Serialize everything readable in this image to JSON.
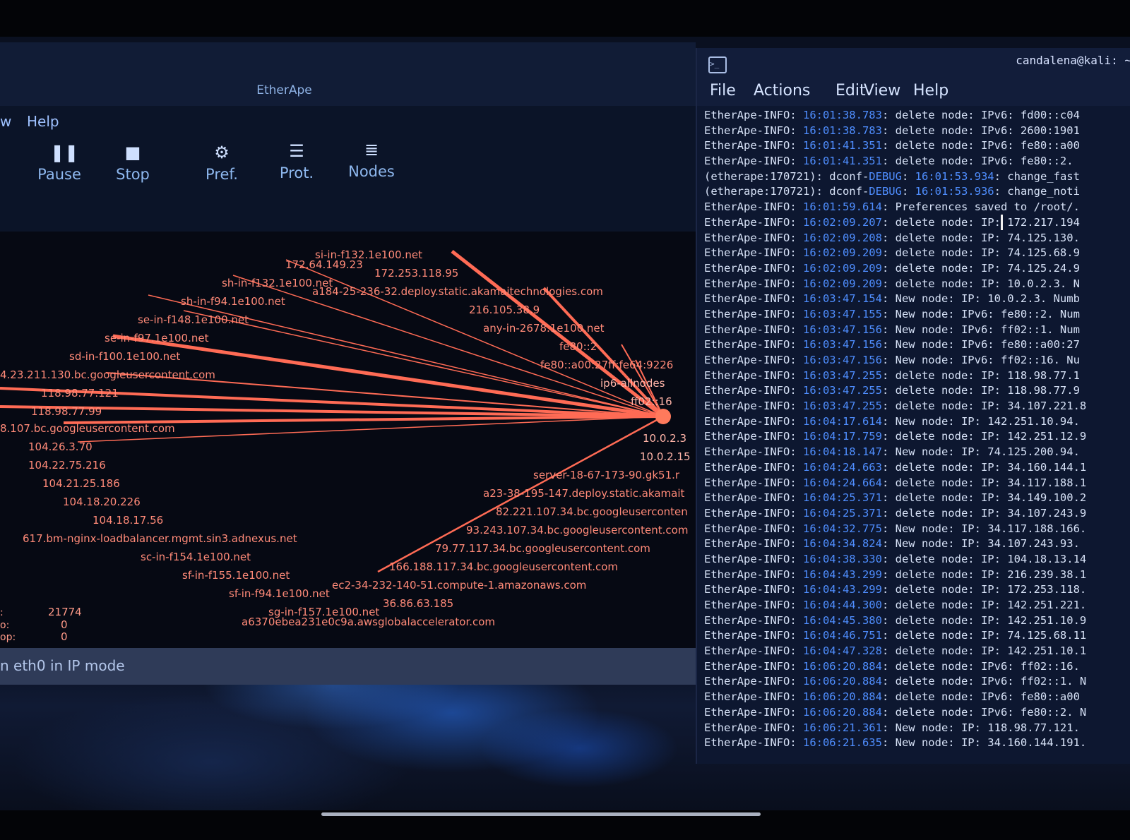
{
  "etherape": {
    "title": "EtherApe",
    "menu": [
      "w",
      "Help"
    ],
    "toolbar": [
      {
        "label": "Pause",
        "icon": "pause-icon"
      },
      {
        "label": "Stop",
        "icon": "stop-icon"
      },
      {
        "label": "Pref.",
        "icon": "preferences-icon"
      },
      {
        "label": "Prot.",
        "icon": "protocols-icon"
      },
      {
        "label": "Nodes",
        "icon": "nodes-icon"
      }
    ],
    "nodes": [
      "si-in-f132.1e100.net",
      "172.64.149.23",
      "172.253.118.95",
      "sh-in-f132.1e100.net",
      "a184-25-236-32.deploy.static.akamaitechnologies.com",
      "sh-in-f94.1e100.net",
      "216.105.38.9",
      "se-in-f148.1e100.net",
      "any-in-2678.1e100.net",
      "se-in-f97.1e100.net",
      "fe80::2",
      "sd-in-f100.1e100.net",
      "fe80::a00:27ff:fe64:9226",
      "4.23.211.130.bc.googleusercontent.com",
      "ip6-allnodes",
      "118.98.77.121",
      "ff02::16",
      "118.98.77.99",
      "8.107.bc.googleusercontent.com",
      "10.0.2.3",
      "104.26.3.70",
      "10.0.2.15",
      "104.22.75.216",
      "server-18-67-173-90.gk51.r",
      "104.21.25.186",
      "a23-38-195-147.deploy.static.akamait",
      "104.18.20.226",
      "82.221.107.34.bc.googleuserconten",
      "104.18.17.56",
      "93.243.107.34.bc.googleusercontent.com",
      "617.bm-nginx-loadbalancer.mgmt.sin3.adnexus.net",
      "79.77.117.34.bc.googleusercontent.com",
      "sc-in-f154.1e100.net",
      "166.188.117.34.bc.googleusercontent.com",
      "sf-in-f155.1e100.net",
      "ec2-34-232-140-51.compute-1.amazonaws.com",
      "sf-in-f94.1e100.net",
      "36.86.63.185",
      "sg-in-f157.1e100.net",
      "a6370ebea231e0c9a.awsglobalaccelerator.com"
    ],
    "stats": {
      "keys": [
        ":",
        "o:",
        "op:"
      ],
      "values": [
        "21774",
        "0",
        "0"
      ]
    },
    "status": "n eth0 in IP mode",
    "colors": {
      "links": "#ff6b55",
      "labels": "#ff8a78",
      "hub": "#ff7a5c"
    }
  },
  "terminal": {
    "user": "candalena@kali: ~",
    "menu": [
      "File",
      "Actions",
      "Edit",
      "View",
      "Help"
    ],
    "log": [
      {
        "p": "EtherApe-INFO: ",
        "t": "16:01:38.783",
        "m": ": delete node: IPv6: fd00::c04"
      },
      {
        "p": "EtherApe-INFO: ",
        "t": "16:01:38.783",
        "m": ": delete node: IPv6: 2600:1901"
      },
      {
        "p": "EtherApe-INFO: ",
        "t": "16:01:41.351",
        "m": ": delete node: IPv6: fe80::a00"
      },
      {
        "p": "EtherApe-INFO: ",
        "t": "16:01:41.351",
        "m": ": delete node: IPv6: fe80::2."
      },
      {
        "p": "(etherape:170721): dconf-",
        "d": "DEBUG",
        "p2": ": ",
        "t": "16:01:53.934",
        "m": ": change_fast"
      },
      {
        "p": "(etherape:170721): dconf-",
        "d": "DEBUG",
        "p2": ": ",
        "t": "16:01:53.936",
        "m": ": change_noti"
      },
      {
        "p": "EtherApe-INFO: ",
        "t": "16:01:59.614",
        "m": ": Preferences saved to /root/."
      },
      {
        "p": "EtherApe-INFO: ",
        "t": "16:02:09.207",
        "m": ": delete node: IP: 172.217.194"
      },
      {
        "p": "EtherApe-INFO: ",
        "t": "16:02:09.208",
        "m": ": delete node: IP: 74.125.130."
      },
      {
        "p": "EtherApe-INFO: ",
        "t": "16:02:09.209",
        "m": ": delete node: IP: 74.125.68.9"
      },
      {
        "p": "EtherApe-INFO: ",
        "t": "16:02:09.209",
        "m": ": delete node: IP: 74.125.24.9"
      },
      {
        "p": "EtherApe-INFO: ",
        "t": "16:02:09.209",
        "m": ": delete node: IP: 10.0.2.3. N"
      },
      {
        "p": "EtherApe-INFO: ",
        "t": "16:03:47.154",
        "m": ": New node: IP: 10.0.2.3. Numb"
      },
      {
        "p": "EtherApe-INFO: ",
        "t": "16:03:47.155",
        "m": ": New node: IPv6: fe80::2. Num"
      },
      {
        "p": "EtherApe-INFO: ",
        "t": "16:03:47.156",
        "m": ": New node: IPv6: ff02::1. Num"
      },
      {
        "p": "EtherApe-INFO: ",
        "t": "16:03:47.156",
        "m": ": New node: IPv6: fe80::a00:27"
      },
      {
        "p": "EtherApe-INFO: ",
        "t": "16:03:47.156",
        "m": ": New node: IPv6: ff02::16. Nu"
      },
      {
        "p": "EtherApe-INFO: ",
        "t": "16:03:47.255",
        "m": ": delete node: IP: 118.98.77.1"
      },
      {
        "p": "EtherApe-INFO: ",
        "t": "16:03:47.255",
        "m": ": delete node: IP: 118.98.77.9"
      },
      {
        "p": "EtherApe-INFO: ",
        "t": "16:03:47.255",
        "m": ": delete node: IP: 34.107.221.8"
      },
      {
        "p": "EtherApe-INFO: ",
        "t": "16:04:17.614",
        "m": ": New node: IP: 142.251.10.94."
      },
      {
        "p": "EtherApe-INFO: ",
        "t": "16:04:17.759",
        "m": ": delete node: IP: 142.251.12.9"
      },
      {
        "p": "EtherApe-INFO: ",
        "t": "16:04:18.147",
        "m": ": New node: IP: 74.125.200.94."
      },
      {
        "p": "EtherApe-INFO: ",
        "t": "16:04:24.663",
        "m": ": delete node: IP: 34.160.144.1"
      },
      {
        "p": "EtherApe-INFO: ",
        "t": "16:04:24.664",
        "m": ": delete node: IP: 34.117.188.1"
      },
      {
        "p": "EtherApe-INFO: ",
        "t": "16:04:25.371",
        "m": ": delete node: IP: 34.149.100.2"
      },
      {
        "p": "EtherApe-INFO: ",
        "t": "16:04:25.371",
        "m": ": delete node: IP: 34.107.243.9"
      },
      {
        "p": "EtherApe-INFO: ",
        "t": "16:04:32.775",
        "m": ": New node: IP: 34.117.188.166."
      },
      {
        "p": "EtherApe-INFO: ",
        "t": "16:04:34.824",
        "m": ": New node: IP: 34.107.243.93."
      },
      {
        "p": "EtherApe-INFO: ",
        "t": "16:04:38.330",
        "m": ": delete node: IP: 104.18.13.14"
      },
      {
        "p": "EtherApe-INFO: ",
        "t": "16:04:43.299",
        "m": ": delete node: IP: 216.239.38.1"
      },
      {
        "p": "EtherApe-INFO: ",
        "t": "16:04:43.299",
        "m": ": delete node: IP: 172.253.118."
      },
      {
        "p": "EtherApe-INFO: ",
        "t": "16:04:44.300",
        "m": ": delete node: IP: 142.251.221."
      },
      {
        "p": "EtherApe-INFO: ",
        "t": "16:04:45.380",
        "m": ": delete node: IP: 142.251.10.9"
      },
      {
        "p": "EtherApe-INFO: ",
        "t": "16:04:46.751",
        "m": ": delete node: IP: 74.125.68.11"
      },
      {
        "p": "EtherApe-INFO: ",
        "t": "16:04:47.328",
        "m": ": delete node: IP: 142.251.10.1"
      },
      {
        "p": "EtherApe-INFO: ",
        "t": "16:06:20.884",
        "m": ": delete node: IPv6: ff02::16."
      },
      {
        "p": "EtherApe-INFO: ",
        "t": "16:06:20.884",
        "m": ": delete node: IPv6: ff02::1. N"
      },
      {
        "p": "EtherApe-INFO: ",
        "t": "16:06:20.884",
        "m": ": delete node: IPv6: fe80::a00"
      },
      {
        "p": "EtherApe-INFO: ",
        "t": "16:06:20.884",
        "m": ": delete node: IPv6: fe80::2. N"
      },
      {
        "p": "EtherApe-INFO: ",
        "t": "16:06:21.361",
        "m": ": New node: IP: 118.98.77.121."
      },
      {
        "p": "EtherApe-INFO: ",
        "t": "16:06:21.635",
        "m": ": New node: IP: 34.160.144.191."
      }
    ],
    "colors": {
      "timestamp": "#4f8eff",
      "text": "#d7e2f7",
      "background": "#0d1730"
    }
  }
}
